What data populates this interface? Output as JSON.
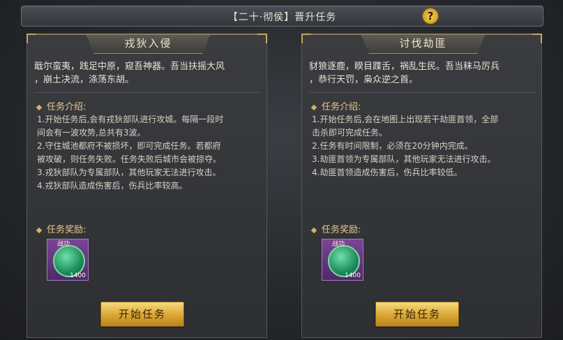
{
  "header": {
    "title": "【二十·彻侯】晋升任务",
    "help_glyph": "?"
  },
  "section_labels": {
    "rules": "任务介绍:",
    "rewards": "任务奖励:"
  },
  "panels": [
    {
      "name": "戎狄入侵",
      "intro": [
        "戢尔蛮夷，践足中原，窥吾神器。吾当扶摇大风",
        "，崩土决流，涤荡东胡。"
      ],
      "rules": [
        "1.开始任务后,会有戎狄部队进行攻城。每隔一段时",
        "间会有一波攻势,总共有3波。",
        "2.守住城池都府不被损坏，即可完成任务。若都府",
        "被攻破，则任务失败。任务失败后城市会被掠夺。",
        "3.戎狄部队为专属部队，其他玩家无法进行攻击。",
        "4.戎狄部队造成伤害后，伤兵比率较高。"
      ],
      "reward": {
        "label": "战功",
        "quantity": "1400"
      },
      "button": "开始任务"
    },
    {
      "name": "讨伐劫匪",
      "intro": [
        "豺狼逐鹿，睽目蹀舌，祸乱生民。吾当秣马厉兵",
        "，恭行天罚，枭众逆之首。"
      ],
      "rules": [
        "1.开始任务后,会在地图上出现若干劫匪首领，全部",
        "击杀即可完成任务。",
        "2.任务有时间限制，必须在20分钟内完成。",
        "3.劫匪首领为专属部队，其他玩家无法进行攻击。",
        "4.劫匪首领造成伤害后，伤兵比率较低。"
      ],
      "reward": {
        "label": "战功",
        "quantity": "1400"
      },
      "button": "开始任务"
    }
  ]
}
